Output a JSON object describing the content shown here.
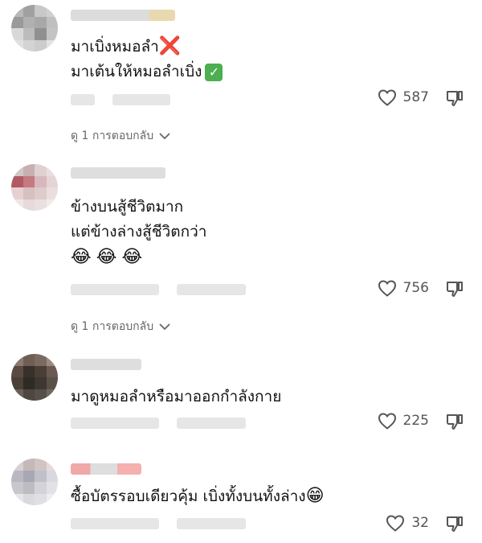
{
  "comments": [
    {
      "lines": [
        "มาเบิ่งหมอลำ",
        "มาเต้นให้หมอลำเบิ่ง"
      ],
      "line_marks": [
        "❌",
        "✅"
      ],
      "likes": "587",
      "replies_label": "ดู 1 การตอบกลับ"
    },
    {
      "lines": [
        "ข้างบนสู้ชีวิตมาก",
        "แต่ข้างล่างสู้ชีวิตกว่า"
      ],
      "emojis": [
        "😂",
        "😂",
        "😂"
      ],
      "likes": "756",
      "replies_label": "ดู 1 การตอบกลับ"
    },
    {
      "lines": [
        "มาดูหมอลำหรือมาออกกำลังกาย"
      ],
      "likes": "225"
    },
    {
      "lines": [
        "ซื้อบัตรรอบเดียวคุ้ม เบิ่งทั้งบนทั้งล่าง"
      ],
      "trailing_emoji": "😁",
      "likes": "32"
    }
  ],
  "icons": {
    "like": "heart-outline-icon",
    "dislike": "thumbs-down-icon",
    "chevron": "chevron-down-icon"
  },
  "colors": {
    "text": "#111111",
    "secondary": "#666666",
    "cross": "#d63447",
    "check": "#4caf50"
  }
}
